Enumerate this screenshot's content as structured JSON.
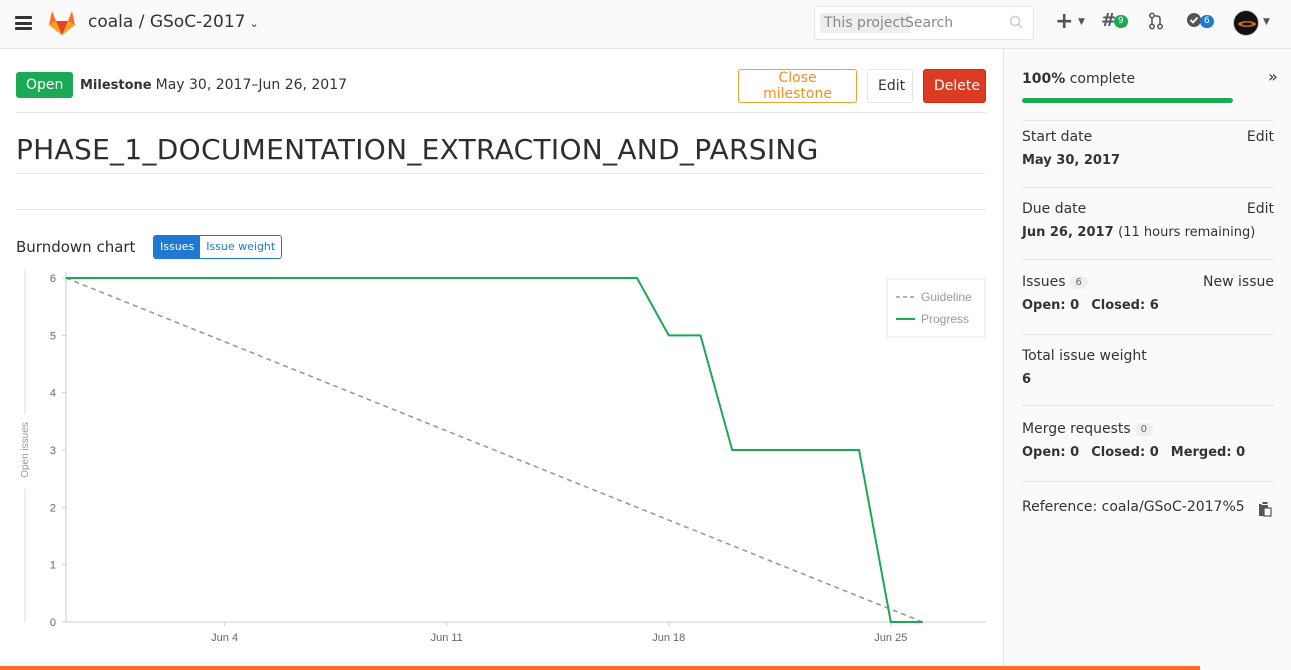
{
  "nav": {
    "breadcrumb": "coala / GSoC-2017",
    "breadcrumb_caret": "⌄",
    "search_scope": "This project",
    "search_placeholder": "Search",
    "issues_count": "9",
    "todos_count": "6",
    "icons": [
      "hamburger-icon",
      "gitlab-logo",
      "search-icon",
      "plus-icon",
      "issues-icon",
      "merge-request-icon",
      "todo-icon",
      "user-avatar"
    ]
  },
  "milestone": {
    "status": "Open",
    "label": "Milestone",
    "date_range": "May 30, 2017–Jun 26, 2017",
    "title": "PHASE_1_DOCUMENTATION_EXTRACTION_AND_PARSING",
    "buttons": {
      "close": "Close milestone",
      "edit": "Edit",
      "delete": "Delete"
    }
  },
  "burndown": {
    "title": "Burndown chart",
    "toggle": {
      "issues": "Issues",
      "weight": "Issue weight",
      "active": "issues"
    }
  },
  "chart_data": {
    "type": "line",
    "ylabel": "Open issues",
    "ylim": [
      0,
      6
    ],
    "yticks": [
      "0",
      "1",
      "2",
      "3",
      "4",
      "5",
      "6"
    ],
    "xlim": [
      "2017-05-30",
      "2017-06-28"
    ],
    "xticks": [
      {
        "label": "Jun 4",
        "x": "2017-06-04"
      },
      {
        "label": "Jun 11",
        "x": "2017-06-11"
      },
      {
        "label": "Jun 18",
        "x": "2017-06-18"
      },
      {
        "label": "Jun 25",
        "x": "2017-06-25"
      }
    ],
    "series": [
      {
        "name": "Guideline",
        "color": "#999999",
        "dashed": true,
        "points": [
          [
            "2017-05-30",
            6
          ],
          [
            "2017-06-26",
            0
          ]
        ]
      },
      {
        "name": "Progress",
        "color": "#1aaa55",
        "dashed": false,
        "points": [
          [
            "2017-05-30",
            6
          ],
          [
            "2017-06-17",
            6
          ],
          [
            "2017-06-18",
            5
          ],
          [
            "2017-06-19",
            5
          ],
          [
            "2017-06-20",
            3
          ],
          [
            "2017-06-24",
            3
          ],
          [
            "2017-06-25",
            0
          ],
          [
            "2017-06-26",
            0
          ]
        ]
      }
    ],
    "legend_position": "top-right",
    "grid": false
  },
  "sidebar": {
    "complete_pct": "100%",
    "complete_label": "complete",
    "progress": 1.0,
    "collapse": "»",
    "start_label": "Start date",
    "start_value": "May 30, 2017",
    "due_label": "Due date",
    "due_value": "Jun 26, 2017",
    "due_remaining": "(11 hours remaining)",
    "edit": "Edit",
    "issues_label": "Issues",
    "issues_count": "6",
    "new_issue": "New issue",
    "issues_open": "Open: 0",
    "issues_closed": "Closed: 6",
    "weight_label": "Total issue weight",
    "weight_value": "6",
    "mr_label": "Merge requests",
    "mr_count": "0",
    "mr_open": "Open: 0",
    "mr_closed": "Closed: 0",
    "mr_merged": "Merged: 0",
    "reference": "Reference: coala/GSoC-2017%5"
  }
}
